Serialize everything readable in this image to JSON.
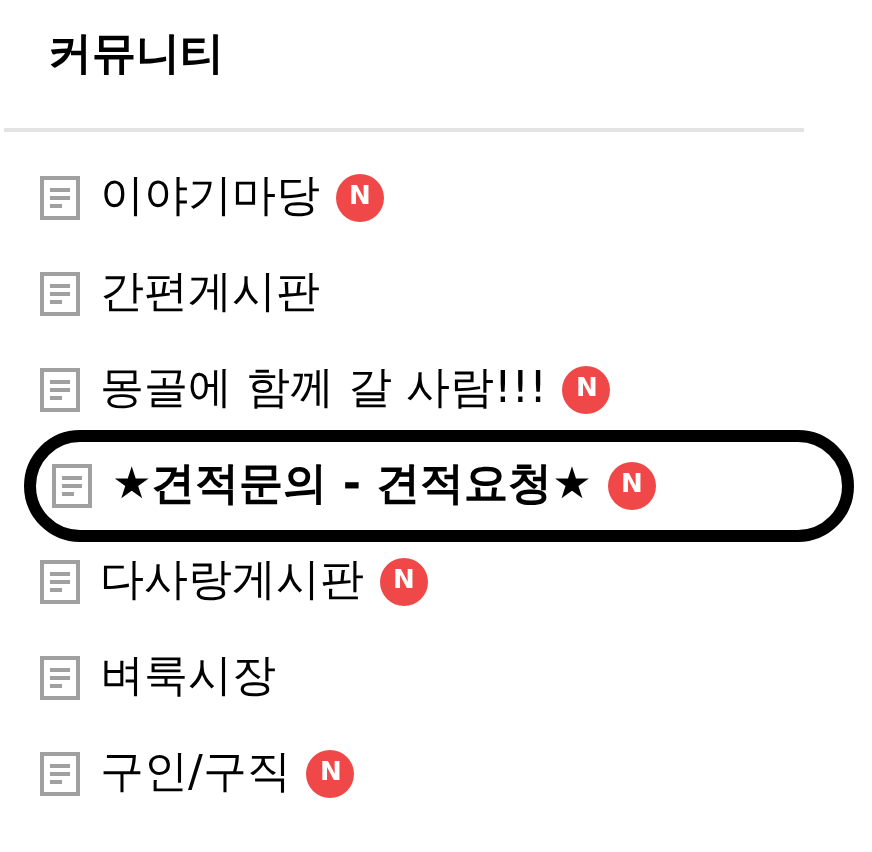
{
  "title": "커뮤니티",
  "items": [
    {
      "label": "이야기마당",
      "badge": "N",
      "highlighted": false
    },
    {
      "label": "간편게시판",
      "highlighted": false
    },
    {
      "label": "몽골에 함께 갈 사람!!!",
      "badge": "N",
      "highlighted": false
    },
    {
      "label": "★견적문의 - 견적요청★",
      "badge": "N",
      "highlighted": true
    },
    {
      "label": "다사랑게시판",
      "badge": "N",
      "highlighted": false
    },
    {
      "label": "벼룩시장",
      "highlighted": false
    },
    {
      "label": "구인/구직",
      "badge": "N",
      "highlighted": false
    }
  ]
}
